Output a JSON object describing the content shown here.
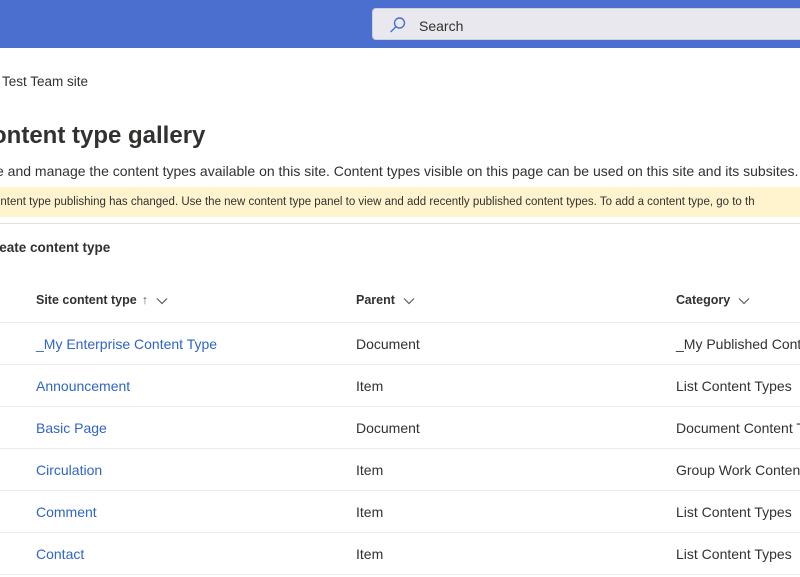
{
  "header": {
    "search_placeholder": "Search",
    "accent_color": "#4a6fcf"
  },
  "breadcrumb": "Test Team site",
  "page": {
    "title": "ontent type gallery",
    "description": "e and manage the content types available on this site. Content types visible on this page can be used on this site and its subsites.",
    "notice": "ontent type publishing has changed. Use the new content type panel to view and add recently published content types. To add a content type, go to th",
    "create_label": "reate content type"
  },
  "table": {
    "columns": [
      {
        "label": "Site content type",
        "sort": "ascending"
      },
      {
        "label": "Parent"
      },
      {
        "label": "Category"
      }
    ],
    "rows": [
      {
        "name": "_My Enterprise Content Type",
        "parent": "Document",
        "category": "_My Published Conte"
      },
      {
        "name": "Announcement",
        "parent": "Item",
        "category": "List Content Types"
      },
      {
        "name": "Basic Page",
        "parent": "Document",
        "category": "Document Content T"
      },
      {
        "name": "Circulation",
        "parent": "Item",
        "category": "Group Work Conten"
      },
      {
        "name": "Comment",
        "parent": "Item",
        "category": "List Content Types"
      },
      {
        "name": "Contact",
        "parent": "Item",
        "category": "List Content Types"
      }
    ]
  }
}
